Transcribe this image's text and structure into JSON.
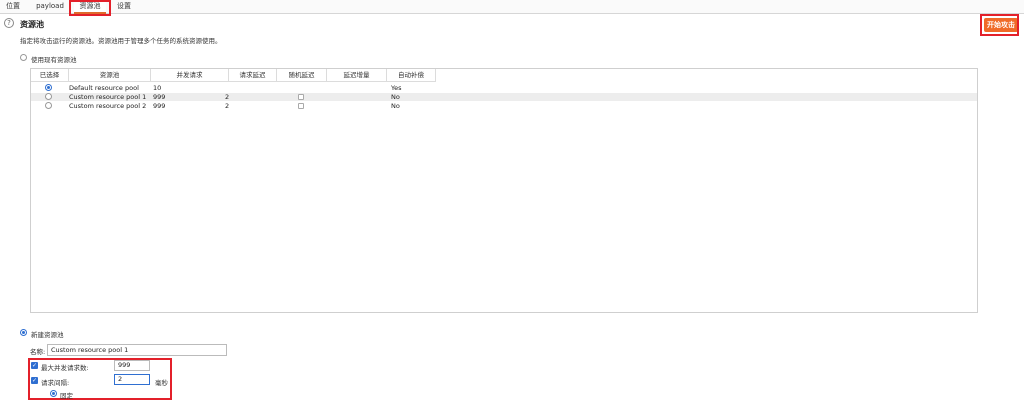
{
  "tabs": [
    {
      "label": "位置"
    },
    {
      "label": "payload"
    },
    {
      "label": "资源池"
    },
    {
      "label": "设置"
    }
  ],
  "start_button": "开始攻击",
  "section": {
    "title": "资源池",
    "description": "指定将攻击运行的资源池。资源池用于管理多个任务的系统资源使用。"
  },
  "use_existing_label": "使用现有资源池",
  "table": {
    "headers": [
      "已选择",
      "资源池",
      "并发请求",
      "请求延迟",
      "随机延迟",
      "延迟增量",
      "自动补偿"
    ],
    "rows": [
      {
        "selected": true,
        "name": "Default resource pool",
        "concurrent": "10",
        "delay": "",
        "random": false,
        "increment": "",
        "auto": "Yes"
      },
      {
        "selected": false,
        "name": "Custom resource pool 1",
        "concurrent": "999",
        "delay": "2",
        "random": true,
        "increment": "",
        "auto": "No"
      },
      {
        "selected": false,
        "name": "Custom resource pool 2",
        "concurrent": "999",
        "delay": "2",
        "random": true,
        "increment": "",
        "auto": "No"
      }
    ]
  },
  "new_pool": {
    "label": "新建资源池",
    "name_label": "名称:",
    "name_value": "Custom resource pool 1",
    "max_concurrent_label": "最大并发请求数:",
    "max_concurrent_value": "999",
    "delay_label": "请求间隔:",
    "delay_value": "2",
    "delay_unit": "毫秒",
    "fixed_label": "固定"
  },
  "colors": {
    "accent": "#f06a28",
    "highlight": "#e3202a",
    "radio": "#2f6fd1"
  }
}
